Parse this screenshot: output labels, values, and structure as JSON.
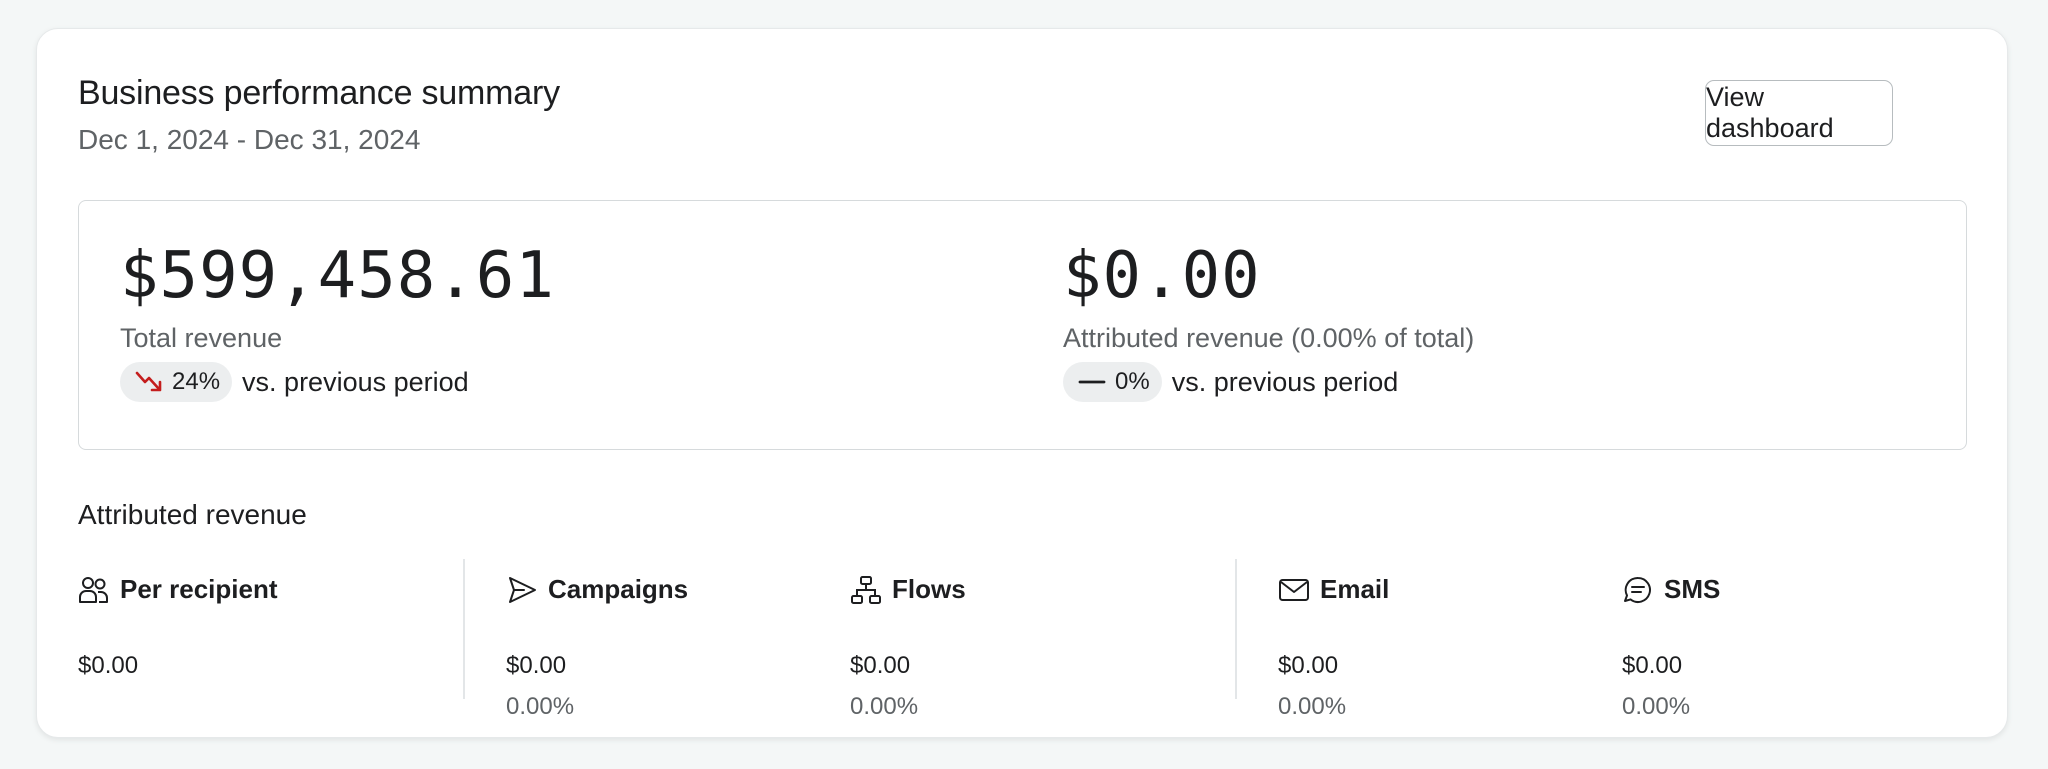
{
  "header": {
    "title": "Business performance summary",
    "date_range": "Dec 1, 2024 - Dec 31, 2024",
    "view_dashboard_label": "View dashboard"
  },
  "summary": {
    "total": {
      "value": "$599,458.61",
      "label": "Total revenue",
      "change": "24%",
      "change_direction": "down",
      "change_icon": "trend-down-icon",
      "comparison": "vs. previous period"
    },
    "attributed": {
      "value": "$0.00",
      "label": "Attributed revenue (0.00% of total)",
      "change": "0%",
      "change_direction": "flat",
      "change_icon": "dash-icon",
      "comparison": "vs. previous period"
    }
  },
  "attributed_revenue": {
    "title": "Attributed revenue",
    "metrics": [
      {
        "label": "Per recipient",
        "icon": "users-icon",
        "value": "$0.00"
      },
      {
        "label": "Campaigns",
        "icon": "send-icon",
        "value": "$0.00",
        "percent": "0.00%"
      },
      {
        "label": "Flows",
        "icon": "flow-icon",
        "value": "$0.00",
        "percent": "0.00%"
      },
      {
        "label": "Email",
        "icon": "mail-icon",
        "value": "$0.00",
        "percent": "0.00%"
      },
      {
        "label": "SMS",
        "icon": "message-icon",
        "value": "$0.00",
        "percent": "0.00%"
      }
    ]
  },
  "colors": {
    "negative_trend": "#c41d1d",
    "muted_text": "#5f6366",
    "pill_background": "#eceeef"
  }
}
